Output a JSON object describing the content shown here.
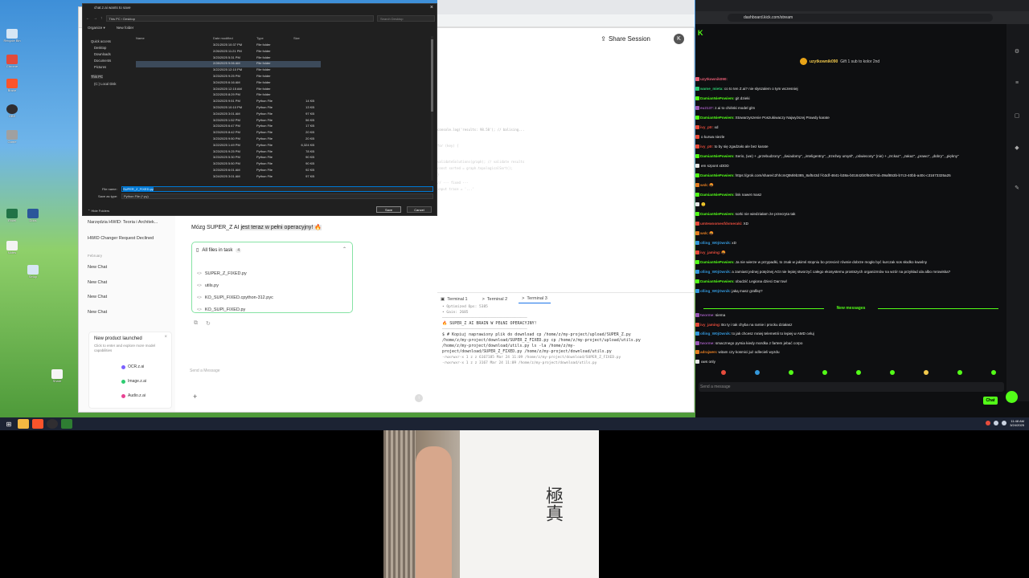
{
  "dialog": {
    "title": "chat.z.ai wants to save",
    "path": "This PC  ›  Desktop",
    "search_placeholder": "Search Desktop",
    "toolbar": [
      "Organize ▾",
      "New folder"
    ],
    "nav_pane": [
      "Quick access",
      "Desktop",
      "Downloads",
      "Documents",
      "Pictures",
      "This PC",
      "(C:) Local Disk"
    ],
    "columns": {
      "name": "Name",
      "date": "Date modified",
      "type": "Type",
      "size": "Size"
    },
    "files": [
      {
        "name": "AGI_MONOLIT",
        "date": "3/21/2025 10:37 PM",
        "type": "File folder",
        "size": "",
        "kind": "folder"
      },
      {
        "name": "DEFENDWIRE_FAKELT_HIERARCHY_SILNIK",
        "date": "2/26/2025 11:21 PM",
        "type": "File folder",
        "size": "",
        "kind": "folder"
      },
      {
        "name": "Drift-Kwasowka",
        "date": "3/23/2025 5:31 PM",
        "type": "File folder",
        "size": "",
        "kind": "folder"
      },
      {
        "name": "FOREKSAS_PRIVATE",
        "date": "2/28/2025 9:06 AM",
        "type": "File folder",
        "size": "",
        "kind": "folder",
        "selected": true
      },
      {
        "name": "HWID",
        "date": "3/22/2025 12:10 PM",
        "type": "File folder",
        "size": "",
        "kind": "folder"
      },
      {
        "name": "MODELS",
        "date": "3/23/2025 9:25 PM",
        "type": "File folder",
        "size": "",
        "kind": "folder"
      },
      {
        "name": "New folder",
        "date": "3/24/2025 6:16 AM",
        "type": "File folder",
        "size": "",
        "kind": "folder"
      },
      {
        "name": "PAKIET DOWODY NA MICROSOFT",
        "date": "3/24/2025 12:15 AM",
        "type": "File folder",
        "size": "",
        "kind": "folder"
      },
      {
        "name": "system",
        "date": "3/22/2025 8:29 PM",
        "type": "File folder",
        "size": "",
        "kind": "folder"
      },
      {
        "name": "badacze_jadzia.py",
        "date": "3/23/2025 9:51 PM",
        "type": "Python File",
        "size": "14 KB",
        "kind": "py"
      },
      {
        "name": "badacze_jadziaTE.py",
        "date": "3/23/2025 10:10 PM",
        "type": "Python File",
        "size": "13 KB",
        "kind": "py"
      },
      {
        "name": "CLAMOWLLOGISTRAMESC_FORENSIC.py",
        "date": "3/24/2025 3:01 AM",
        "type": "Python File",
        "size": "97 KB",
        "kind": "py"
      },
      {
        "name": "COSMIC.py",
        "date": "3/23/2025 1:52 PM",
        "type": "Python File",
        "size": "56 KB",
        "kind": "py"
      },
      {
        "name": "def_analyze02.py",
        "date": "3/23/2025 6:47 PM",
        "type": "Python File",
        "size": "17 KB",
        "kind": "py"
      },
      {
        "name": "edytor.py",
        "date": "3/23/2025 8:42 PM",
        "type": "Python File",
        "size": "20 KB",
        "kind": "py"
      },
      {
        "name": "edytor_naprawiony.py",
        "date": "3/23/2025 9:50 PM",
        "type": "Python File",
        "size": "20 KB",
        "kind": "py"
      },
      {
        "name": "KOSMICZNA POTEGA.py",
        "date": "3/22/2025 1:49 PM",
        "type": "Python File",
        "size": "6,324 KB",
        "kind": "py"
      },
      {
        "name": "LOGISTRAMESC_FFFFFFFFFFFF (7).py",
        "date": "3/23/2025 9:25 PM",
        "type": "Python File",
        "size": "78 KB",
        "kind": "py"
      },
      {
        "name": "LOGISTRAMESC_FFFFFFFFFFFF.py",
        "date": "3/23/2025 5:30 PM",
        "type": "Python File",
        "size": "90 KB",
        "kind": "py"
      },
      {
        "name": "logistramesc_v3_LAST WORK.py",
        "date": "3/23/2025 5:50 PM",
        "type": "Python File",
        "size": "90 KB",
        "kind": "py"
      },
      {
        "name": "logistramesc_v3_LAST WORKuesfuesfuesf.py",
        "date": "3/23/2025 6:01 AM",
        "type": "Python File",
        "size": "92 KB",
        "kind": "py"
      },
      {
        "name": "LOGISTRAMESC_FORENSIC - Copy.py",
        "date": "3/24/2025 3:01 AM",
        "type": "Python File",
        "size": "97 KB",
        "kind": "py"
      }
    ],
    "file_name_label": "File name:",
    "file_name": "SUPER_Z_FIXED.py",
    "save_type_label": "Save as type:",
    "save_type": "Python File (*.py)",
    "hide_folders": "Hide Folders",
    "save": "Save",
    "cancel": "Cancel"
  },
  "chat_app": {
    "share": "Share Session",
    "avatar": "K",
    "sidebar": {
      "items_top": [
        "Narzędzia HWID: Teoria i Architek...",
        "HWID Changer Request Declined"
      ],
      "section": "February",
      "items": [
        "New Chat",
        "New Chat",
        "New Chat",
        "New Chat"
      ]
    },
    "new_product": {
      "title": "New product launched",
      "desc": "Click to enter and explore more model capabilities",
      "items": [
        "OCR.z.ai",
        "Image.z.ai",
        "Audio.z.ai"
      ]
    },
    "message": {
      "pre": "Mózg SUPER_Z AI ",
      "highlight": "jest teraz w pełni operacyjny! ",
      "emoji": "🔥"
    },
    "files": {
      "title": "All files in task",
      "count": "4",
      "list": [
        "SUPER_Z_FIXED.py",
        "utils.py",
        "KO_SUPI_FIXED.cpython-312.pyc",
        "KO_SUPI_FIXED.py"
      ]
    },
    "send_placeholder": "Send a Message",
    "code_lines": [
      "console.log('results: 98.58'); // balising...",
      "for (key) {",
      "  validateSolutions(graph); // validate results",
      "  const sorted = graph.topologicalSort();",
      "}",
      "// --- fixed --- ",
      "  input trace = '...'"
    ],
    "terminal": {
      "tabs": [
        "Terminal 1",
        "Terminal 2",
        "Terminal 3"
      ],
      "lines": [
        "• Optimized Ops: 5385",
        "• Gain: 2685",
        "———————————————————————————————————————",
        "🔥 SUPER_Z AI BRAIN W PEŁNI OPERACYJNY!",
        "———————————————————————————————————————",
        "$ # Kopiuj naprawiony plik do download cp /home/z/my-project/upload/SUPER_Z.py",
        "/home/z/my-project/download/SUPER_Z_FIXED.py cp /home/z/my-project/upload/utils.py",
        "/home/z/my-project/download/utils.py ls -la /home/z/my-",
        "project/download/SUPER_Z_FIXED.py /home/z/my-project/download/utils.py",
        "-rwxrwxr-x 1 z z 6167185 Mar 24 11:09 /home/z/my-project/download/SUPER_Z_FIXED.py",
        "-rwxrwxr-x 1 z z   3167 Mar 24 11:09 /home/z/my-project/download/utils.py"
      ]
    }
  },
  "kick": {
    "url": "dashboard.kick.com/stream",
    "gift": {
      "user": "uzytkownik090",
      "text": "Gift 1 sub to kolor 2nd"
    },
    "messages": [
      {
        "user": "uzytkownik090:",
        "text": "",
        "color": "#e85d75"
      },
      {
        "user": "wame_mieta:",
        "text": "co to ten Z.ai? nie slyszalem o tym wczesniej",
        "color": "#2ecc71"
      },
      {
        "user": "DamianNiePowiem:",
        "text": "git dzieki",
        "color": "#53fc18"
      },
      {
        "user": "eu2137:",
        "text": "z.ai to chiński model glm",
        "color": "#9b59b6"
      },
      {
        "user": "DamianNiePowiem:",
        "text": "Stowarzyszenie Poszukiwaczy Najwyższej Prawdy karate",
        "color": "#53fc18"
      },
      {
        "user": "ivy_ptr:",
        "text": "xd",
        "color": "#e74c3c"
      },
      {
        "user": "",
        "text": "o kurwa niezle",
        "color": "#e74c3c"
      },
      {
        "user": "ivy_ptr:",
        "text": "to by się zgadzało ale bez karate",
        "color": "#e74c3c"
      },
      {
        "user": "DamianNiePowiem:",
        "text": "Serio, (we) + „przebudzony\", „świadomy\", „inteligentny\", „trzeźwy umysł\", „oświecony\" (nie) + „zrckaz\", „zakaz\", „prawo\", „dobry\", „piękny\"",
        "color": "#53fc18"
      },
      {
        "user": "",
        "text": "em szpont xDDD",
        "color": "#e6e6e6"
      },
      {
        "user": "DamianNiePowiem:",
        "text": "https://grok.com/share/c2hhcmQtMi9b385_8af543d f-b3df-4841-b38a-b01842b0f940?rid=09af853b-b7c3-40bb-a40c-c31673325a25",
        "color": "#53fc18"
      },
      {
        "user": "wsk:",
        "text": "🤬",
        "color": "#e67e22"
      },
      {
        "user": "DamianNiePowiem:",
        "text": "link nawet masz",
        "color": "#53fc18"
      },
      {
        "user": "",
        "text": "🙂",
        "color": "#e6e6e6"
      },
      {
        "user": "DamianNiePowiem:",
        "text": "sorki nie wiedziałam że przecryta tak",
        "color": "#53fc18"
      },
      {
        "user": "umtewoomesfdvmeraki:",
        "text": "XD",
        "color": "#e74c3c"
      },
      {
        "user": "wsk:",
        "text": "🤬",
        "color": "#e67e22"
      },
      {
        "user": "olling_W0jOwnik:",
        "text": "xD",
        "color": "#3498db"
      },
      {
        "user": "ivy_jaming:",
        "text": "🤬",
        "color": "#e74c3c"
      },
      {
        "user": "DamianNiePowiem:",
        "text": "Ja nie wierze w przypadki, to znak w jakimś stopniu bo przecież równie dobrze mogło być kurczak sos słodko kwaśny",
        "color": "#53fc18"
      },
      {
        "user": "olling_W0jOwnik:",
        "text": "a zamiast jednej potężnej AGI nie lepiej stworzyć całego ekosystemu prostszych organizmów na wzór na przykład ula albo mrowiska?",
        "color": "#3498db"
      },
      {
        "user": "DamianNiePowiem:",
        "text": "obudzić Legiona dzieci Dan'owl",
        "color": "#53fc18"
      },
      {
        "user": "olling_W0jOwnik:",
        "text": "jaką masz grafikę?",
        "color": "#3498db"
      }
    ],
    "new_messages": "New messages",
    "messages2": [
      {
        "user": "tworme:",
        "text": "siema",
        "color": "#9b59b6"
      },
      {
        "user": "ivy_jaming:",
        "text": "Bo ty i tak chyba na ramie i procku działasz",
        "color": "#e74c3c"
      },
      {
        "user": "olling_W0jOwnik:",
        "text": "to jak chcesz mniej telemetrii to lepiej w AMD celuj",
        "color": "#3498db"
      },
      {
        "user": "tworme:",
        "text": "smacznego pyrsia kiedy mordka z fartem jebać corpo",
        "color": "#9b59b6"
      },
      {
        "user": "adrajwen:",
        "text": "witam czy kosmici już odlecieli wyzdu",
        "color": "#e67e22"
      },
      {
        "user": "",
        "text": "uws only",
        "color": "#e6e6e6"
      }
    ],
    "send_placeholder": "Send a message",
    "chat_button": "Chat"
  },
  "taskbar": {
    "time": "11:48 AM",
    "date": "3/24/2025"
  },
  "desktop_icons": [
    "Recycle Bin",
    "Chrome",
    "Brave",
    "OBS",
    "Game",
    "Excel",
    "Docs",
    "Notes",
    "Setup",
    "Share"
  ]
}
